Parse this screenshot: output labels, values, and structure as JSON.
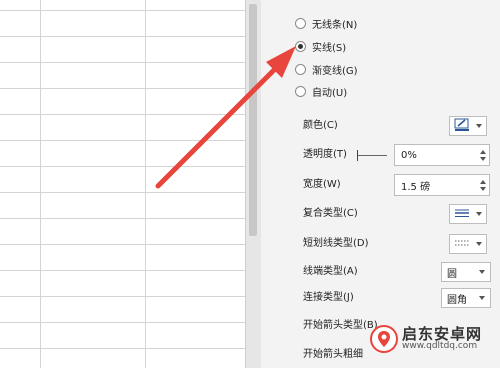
{
  "line_options": [
    {
      "label": "无线条(N)",
      "checked": false
    },
    {
      "label": "实线(S)",
      "checked": true
    },
    {
      "label": "渐变线(G)",
      "checked": false
    },
    {
      "label": "自动(U)",
      "checked": false
    }
  ],
  "props": {
    "color_label": "颜色(C)",
    "transparency_label": "透明度(T)",
    "transparency_value": "0%",
    "width_label": "宽度(W)",
    "width_value": "1.5 磅",
    "compound_label": "复合类型(C)",
    "dash_label": "短划线类型(D)",
    "cap_label": "线端类型(A)",
    "cap_value": "圆",
    "join_label": "连接类型(J)",
    "join_value": "圆角",
    "begin_arrow_type_label": "开始箭头类型(B)",
    "begin_arrow_size_label": "开始箭头粗细"
  },
  "colors": {
    "accent_arrow": "#e8453c",
    "pen": "#2b5797"
  },
  "watermark": {
    "cn": "启东安卓网",
    "url": "www.qdltdq.com"
  }
}
